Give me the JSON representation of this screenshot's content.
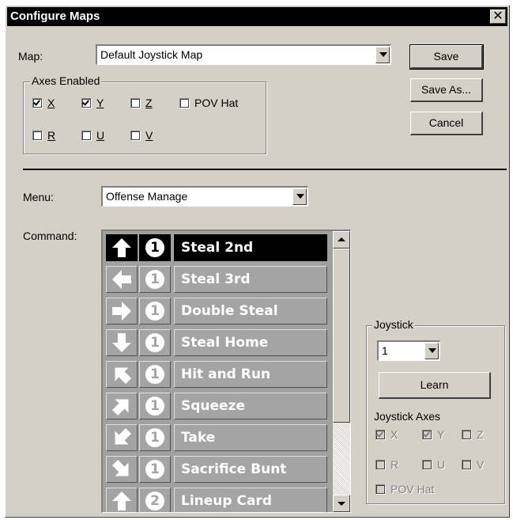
{
  "window": {
    "title": "Configure Maps",
    "close_glyph": "✕"
  },
  "map": {
    "label": "Map:",
    "value": "Default Joystick Map"
  },
  "buttons": {
    "save": "Save",
    "save_as": "Save As...",
    "cancel": "Cancel",
    "learn": "Learn"
  },
  "axes_enabled": {
    "title": "Axes Enabled",
    "items": [
      {
        "label": "X",
        "checked": true
      },
      {
        "label": "Y",
        "checked": true
      },
      {
        "label": "Z",
        "checked": false
      },
      {
        "label": "POV Hat",
        "checked": false
      },
      {
        "label": "R",
        "checked": false
      },
      {
        "label": "U",
        "checked": false
      },
      {
        "label": "V",
        "checked": false
      }
    ]
  },
  "menu": {
    "label": "Menu:",
    "value": "Offense Manage"
  },
  "command": {
    "label": "Command:",
    "items": [
      {
        "dir": "up",
        "num": "1",
        "name": "Steal 2nd",
        "selected": true
      },
      {
        "dir": "left",
        "num": "1",
        "name": "Steal 3rd",
        "selected": false
      },
      {
        "dir": "right",
        "num": "1",
        "name": "Double Steal",
        "selected": false
      },
      {
        "dir": "down",
        "num": "1",
        "name": "Steal Home",
        "selected": false
      },
      {
        "dir": "up-left",
        "num": "1",
        "name": "Hit and Run",
        "selected": false
      },
      {
        "dir": "up-right",
        "num": "1",
        "name": "Squeeze",
        "selected": false
      },
      {
        "dir": "down-left",
        "num": "1",
        "name": "Take",
        "selected": false
      },
      {
        "dir": "down-right",
        "num": "1",
        "name": "Sacrifice Bunt",
        "selected": false
      },
      {
        "dir": "up",
        "num": "2",
        "name": "Lineup Card",
        "selected": false
      }
    ]
  },
  "joystick": {
    "title": "Joystick",
    "value": "1",
    "axes_title": "Joystick Axes",
    "axes": [
      {
        "label": "X",
        "checked": true
      },
      {
        "label": "Y",
        "checked": true
      },
      {
        "label": "Z",
        "checked": false
      },
      {
        "label": "R",
        "checked": false
      },
      {
        "label": "U",
        "checked": false
      },
      {
        "label": "V",
        "checked": false
      },
      {
        "label": "POV Hat",
        "checked": false
      }
    ]
  }
}
